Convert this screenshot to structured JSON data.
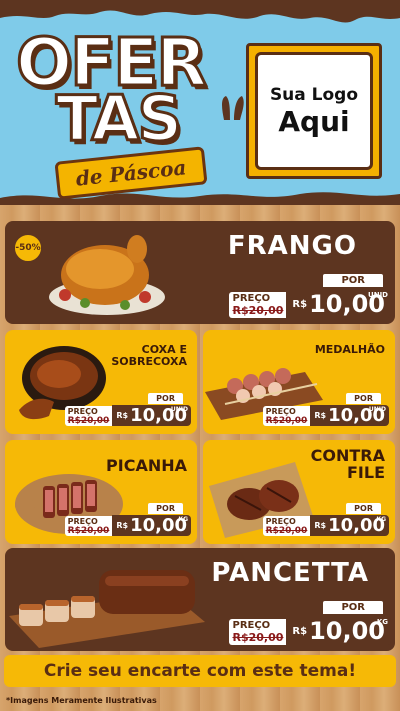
{
  "header": {
    "title_line1": "OFER",
    "title_line2": "TAS",
    "subtitle": "de Páscoa",
    "logo_line1": "Sua Logo",
    "logo_line2": "Aqui"
  },
  "products": {
    "frango": {
      "name": "FRANGO",
      "badge": "-50%",
      "label": "PREÇO",
      "old": "R$20,00",
      "por": "POR",
      "currency": "R$",
      "value": "10,00",
      "unit": "UNID"
    },
    "coxa": {
      "name_l1": "COXA E",
      "name_l2": "SOBRECOXA",
      "label": "PREÇO",
      "old": "R$20,00",
      "por": "POR",
      "currency": "R$",
      "value": "10,00",
      "unit": "UNID"
    },
    "medalhao": {
      "name": "MEDALHÃO",
      "label": "PREÇO",
      "old": "R$20,00",
      "por": "POR",
      "currency": "R$",
      "value": "10,00",
      "unit": "UNID"
    },
    "picanha": {
      "name": "PICANHA",
      "label": "PREÇO",
      "old": "R$20,00",
      "por": "POR",
      "currency": "R$",
      "value": "10,00",
      "unit": "KG"
    },
    "contrafile": {
      "name_l1": "CONTRA",
      "name_l2": "FILE",
      "label": "PREÇO",
      "old": "R$20,00",
      "por": "POR",
      "currency": "R$",
      "value": "10,00",
      "unit": "KG"
    },
    "pancetta": {
      "name": "PANCETTA",
      "label": "PREÇO",
      "old": "R$20,00",
      "por": "POR",
      "currency": "R$",
      "value": "10,00",
      "unit": "KG"
    }
  },
  "banner": "Crie seu encarte com este tema!",
  "note": "*Imagens Meramente Ilustrativas",
  "colors": {
    "chocolate": "#5d3520",
    "yellow": "#f6b906",
    "sky": "#7fcbe9"
  }
}
